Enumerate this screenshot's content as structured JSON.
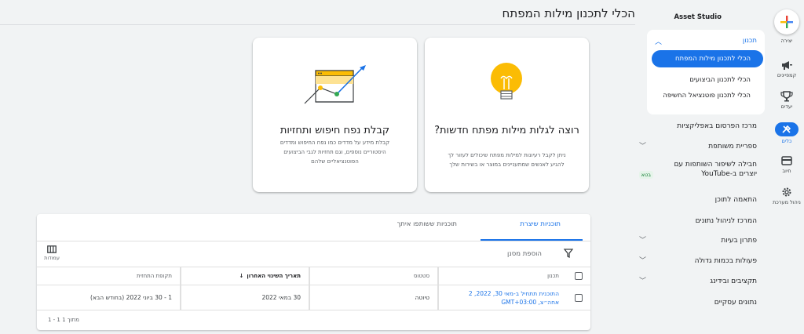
{
  "rail": {
    "create_label": "יצירה",
    "campaigns_label": "קמפיינים",
    "goals_label": "יעדים",
    "tools_label": "כלים",
    "billing_label": "חיוב",
    "admin_label": "ניהול מערכת"
  },
  "nav": {
    "title": "Asset Studio",
    "group_label": "תכנון",
    "sub_keyword_planner": "הכלי לתכנון מילות המפתח",
    "sub_performance_planner": "הכלי לתכנון הביצועים",
    "sub_reach_planner": "הכלי לתכנון פוטנציאל החשיפה",
    "app_ads_hub": "מרכז הפרסום באפליקציות",
    "shared_library": "ספריית משותפת",
    "youtube_creators": "חבילה לשיפור השותפות עם יוצרים ב-YouTube",
    "beta": "בטא",
    "content_suitability": "התאמה לתוכן",
    "data_manager": "המרכז לניהול נתונים",
    "troubleshooting": "פתרון בעיות",
    "bulk_actions": "פעולות בכמות גדולה",
    "budgets_bidding": "תקציבים ובידינג",
    "business_data": "נתונים עסקיים"
  },
  "page": {
    "title": "הכלי לתכנון מילות המפתח"
  },
  "cards": {
    "discover_title": "רוצה לגלות מילות מפתח חדשות?",
    "discover_desc": "ניתן לקבל רעיונות למילות מפתח שיכולים לעזור לך להגיע לאנשים שמתעניינים במוצר או בשירות שלך",
    "forecast_title": "קבלת נפח חיפוש ותחזיות",
    "forecast_desc": "קבלת מידע על מדדים כמו נפח החיפוש ומדדים היסטוריים נוספים, וגם תחזיות לגבי הביצועים הפוטנציאליים שלהם"
  },
  "table": {
    "tab_your_plans": "תוכניות שיצרת",
    "tab_shared": "תוכניות ששותפו איתך",
    "add_filter": "הוספת מסנן",
    "columns_label": "עמודות",
    "headers": {
      "plan": "תכנון",
      "status": "סטטוס",
      "last_modified": "תאריך השינוי האחרון",
      "forecast_period": "תקופת התחזית"
    },
    "rows": [
      {
        "plan": "התוכנית תתחיל ב-מאי 30, 2022, 2 אחה״צ, GMT+03:00",
        "status": "טיוטה",
        "last_modified": "30 במאי 2022",
        "forecast_period": "1 - 30 ביוני 2022 (בחודש הבא)"
      }
    ],
    "pagination": "1 - 1 מתוך 1"
  },
  "colors": {
    "accent": "#1a73e8",
    "bulb": "#fbbc04"
  }
}
